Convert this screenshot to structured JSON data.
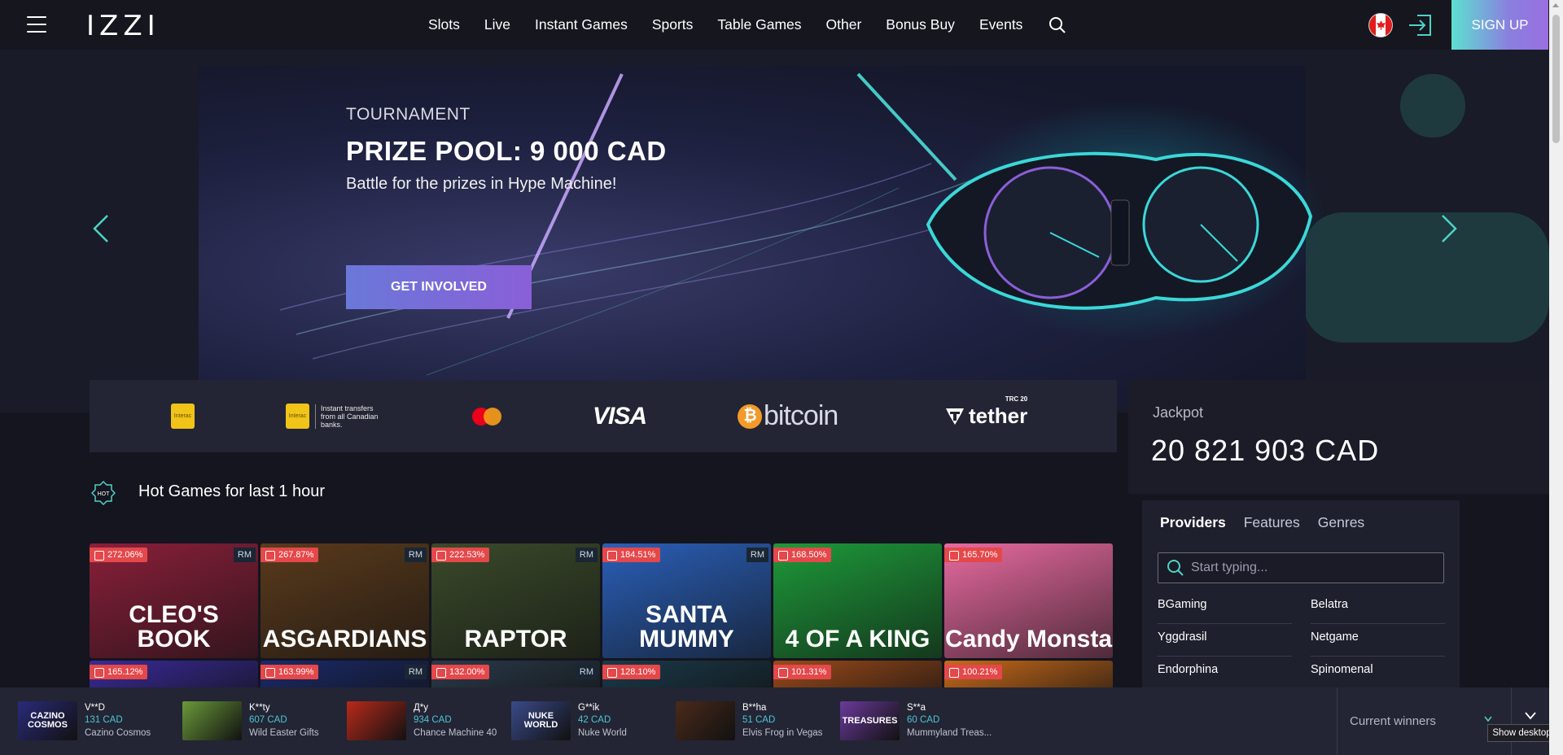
{
  "header": {
    "logo": "IZZI",
    "nav": [
      "Slots",
      "Live",
      "Instant Games",
      "Sports",
      "Table Games",
      "Other",
      "Bonus Buy",
      "Events"
    ],
    "signup_label": "SIGN UP"
  },
  "hero": {
    "subtitle": "TOURNAMENT",
    "title": "PRIZE POOL: 9 000 CAD",
    "description": "Battle for the prizes in Hype Machine!",
    "cta_label": "GET INVOLVED"
  },
  "payments": {
    "interac_label": "Interac",
    "interac_note": "Instant transfers from all Canadian banks.",
    "visa": "VISA",
    "bitcoin": "bitcoin",
    "bitcoin_symbol": "₿",
    "tether": "tether",
    "tether_tag": "TRC 20"
  },
  "jackpot": {
    "label": "Jackpot",
    "value": "20 821 903 CAD"
  },
  "hot_games": {
    "icon_text": "HOT",
    "title": "Hot Games for last 1 hour",
    "rm_label": "RM",
    "row1": [
      {
        "pct": "272.06%",
        "rm": true,
        "name": "CLEO'S BOOK",
        "bg": "#8a1f3a"
      },
      {
        "pct": "267.87%",
        "rm": true,
        "name": "ASGARDIANS",
        "bg": "#5a3a1c"
      },
      {
        "pct": "222.53%",
        "rm": true,
        "name": "RAPTOR",
        "bg": "#3a4a2a"
      },
      {
        "pct": "184.51%",
        "rm": true,
        "name": "SANTA MUMMY",
        "bg": "#2a5fb8"
      },
      {
        "pct": "168.50%",
        "rm": false,
        "name": "4 OF A KING",
        "bg": "#1d9a3a"
      },
      {
        "pct": "165.70%",
        "rm": false,
        "name": "Candy Monsta",
        "bg": "#e86aa0"
      }
    ],
    "row2": [
      {
        "pct": "165.12%",
        "rm": false,
        "bg": "#3a2a9a"
      },
      {
        "pct": "163.99%",
        "rm": true,
        "bg": "#1a2a6a"
      },
      {
        "pct": "132.00%",
        "rm": true,
        "bg": "#2a3a4a"
      },
      {
        "pct": "128.10%",
        "rm": false,
        "bg": "#1a3a4a"
      },
      {
        "pct": "101.31%",
        "rm": false,
        "bg": "#9a4a1a"
      },
      {
        "pct": "100.21%",
        "rm": false,
        "bg": "#c86a1a"
      }
    ]
  },
  "providers": {
    "tabs": [
      "Providers",
      "Features",
      "Genres"
    ],
    "search_placeholder": "Start typing...",
    "items": [
      "BGaming",
      "Belatra",
      "Yggdrasil",
      "Netgame",
      "Endorphina",
      "Spinomenal"
    ]
  },
  "winners": [
    {
      "name": "V**D",
      "amount": "131 CAD",
      "game": "Cazino Cosmos",
      "thumb": "CAZINO COSMOS",
      "bg": "#2a2a7a"
    },
    {
      "name": "K**ty",
      "amount": "607 CAD",
      "game": "Wild Easter Gifts",
      "thumb": "",
      "bg": "#6a9a3a"
    },
    {
      "name": "Д*у",
      "amount": "934 CAD",
      "game": "Chance Machine 40",
      "thumb": "",
      "bg": "#b82a1a"
    },
    {
      "name": "G**ik",
      "amount": "42 CAD",
      "game": "Nuke World",
      "thumb": "NUKE WORLD",
      "bg": "#3a4a8a"
    },
    {
      "name": "B**ha",
      "amount": "51 CAD",
      "game": "Elvis Frog in Vegas",
      "thumb": "",
      "bg": "#4a2a1a"
    },
    {
      "name": "S**a",
      "amount": "60 CAD",
      "game": "Mummyland Treas...",
      "thumb": "TREASURES",
      "bg": "#6a3a9a"
    }
  ],
  "current_winners_label": "Current winners",
  "tooltip": "Show desktop"
}
